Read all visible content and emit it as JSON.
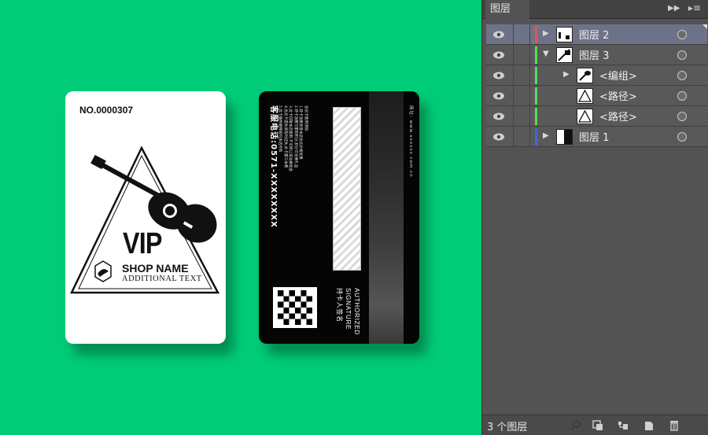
{
  "artwork": {
    "front": {
      "card_number": "NO.0000307",
      "vip": "VIP",
      "shop_name": "SHOP NAME",
      "additional_text": "ADDITIONAL TEXT"
    },
    "back": {
      "hotline": "客服电话:0571-XXXXXXXX",
      "rules": [
        "会员卡使用须知:",
        "1.持卡消费享受本店会员价格优惠",
        "2.持卡消费可累积积分,积分可兑换礼品",
        "3.此卡仅限本店使用,不可转让或兑换现金",
        "4.会员卡遗失请及时挂失,补卡需工本费",
        "5.此卡最终解释权归本店所有"
      ],
      "website": "网址: www.xxxxxx.com.cn",
      "authorized": "AUTHORIZED",
      "signature": "SIGNATURE",
      "cardholder_sign": "持卡人签名"
    }
  },
  "layers_panel": {
    "tab_label": "图层",
    "collapse_icon": "double-chevron-right-icon",
    "menu_icon": "panel-menu-icon",
    "layers": [
      {
        "name": "图层 2",
        "expander": "▶",
        "color": "#e05555",
        "selected": true
      },
      {
        "name": "图层 3",
        "expander": "▼",
        "color": "#55dd55",
        "selected": false
      },
      {
        "name": "<编组>",
        "expander": "▶",
        "color": "#55dd55",
        "selected": false
      },
      {
        "name": "<路径>",
        "expander": "",
        "color": "#55dd55",
        "selected": false
      },
      {
        "name": "<路径>",
        "expander": "",
        "color": "#55dd55",
        "selected": false
      },
      {
        "name": "图层 1",
        "expander": "▶",
        "color": "#4466dd",
        "selected": false
      }
    ],
    "footer": {
      "layer_count": "3 个图层",
      "icons": [
        "search-icon",
        "clipping-mask-icon",
        "new-sublayer-icon",
        "new-layer-icon",
        "delete-icon"
      ]
    }
  }
}
